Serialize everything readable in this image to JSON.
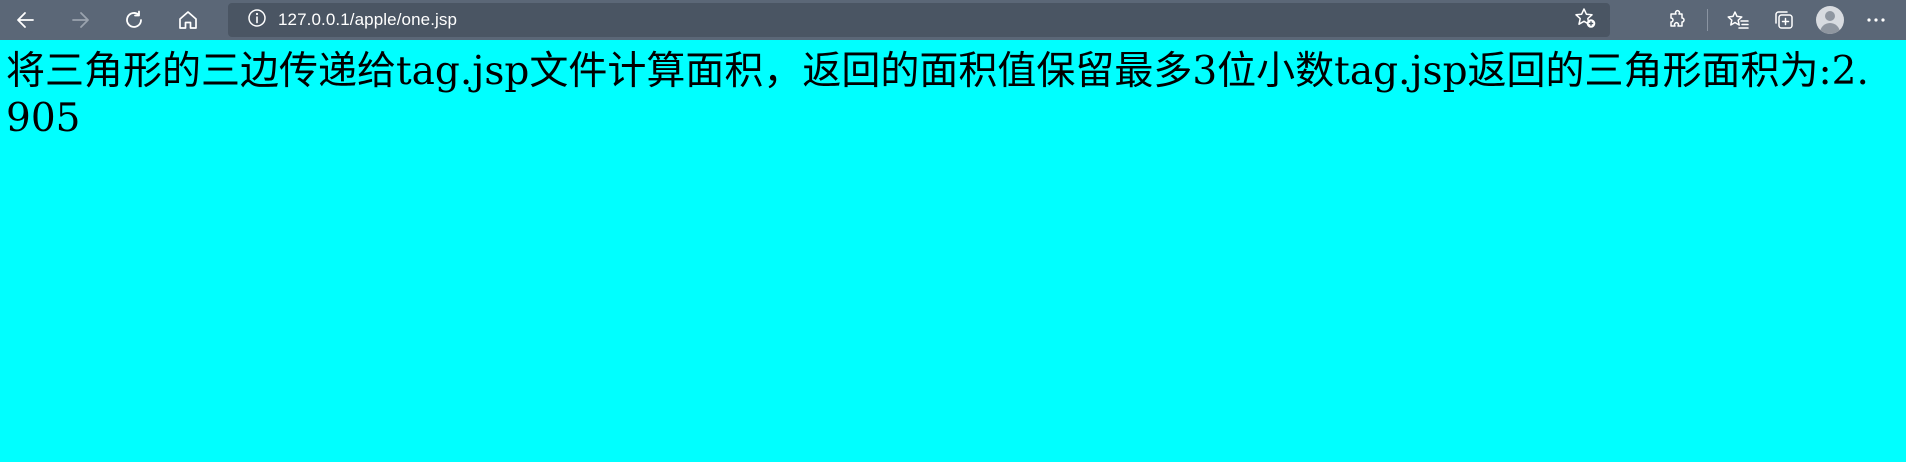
{
  "browser": {
    "url": "127.0.0.1/apple/one.jsp",
    "icons": {
      "back": "back-arrow-icon",
      "forward": "forward-arrow-icon",
      "refresh": "refresh-icon",
      "home": "home-icon",
      "info": "info-icon",
      "add_favorite": "add-favorite-star-icon",
      "extensions": "extensions-puzzle-icon",
      "favorites": "favorites-icon",
      "collections": "collections-icon",
      "profile": "profile-avatar-icon",
      "more": "more-menu-icon"
    },
    "toolbar_color": "#5b6777",
    "address_bar_color": "#4a5563"
  },
  "page": {
    "background_color": "#00ffff",
    "text_color": "#000000",
    "message": "将三角形的三边传递给tag.jsp文件计算面积，返回的面积值保留最多3位小数tag.jsp返回的三角形面积为:2.905"
  }
}
